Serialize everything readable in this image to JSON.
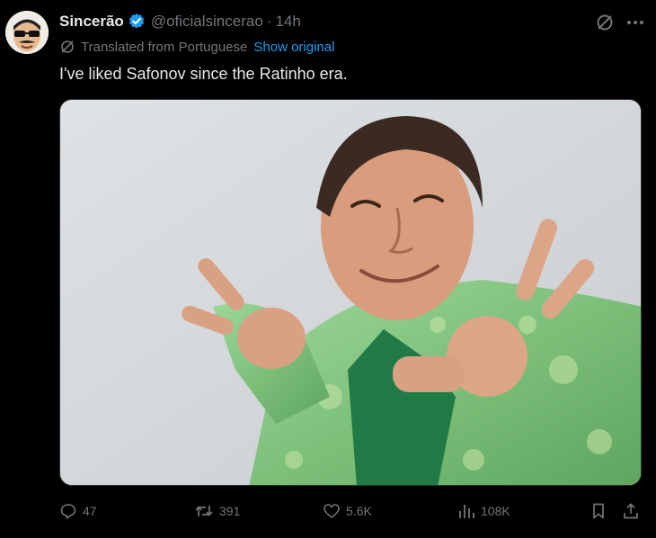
{
  "author": {
    "display_name": "Sincerão",
    "handle": "@oficialsincerao",
    "separator": "·",
    "time": "14h",
    "verified_icon": "verified-badge-icon",
    "avatar": "cartoon-avatar-with-sunglasses"
  },
  "translation": {
    "label": "Translated from Portuguese",
    "action": "Show original",
    "icon": "translate-icon"
  },
  "tweet": {
    "text": "I've liked Safonov since the Ratinho era."
  },
  "media": {
    "description_icon": "photo"
  },
  "actions": {
    "replies": "47",
    "reposts": "391",
    "likes": "5.6K",
    "views": "108K"
  },
  "colors": {
    "background": "#000000",
    "text": "#e7e9ea",
    "muted": "#71767b",
    "link": "#1d9bf0"
  }
}
